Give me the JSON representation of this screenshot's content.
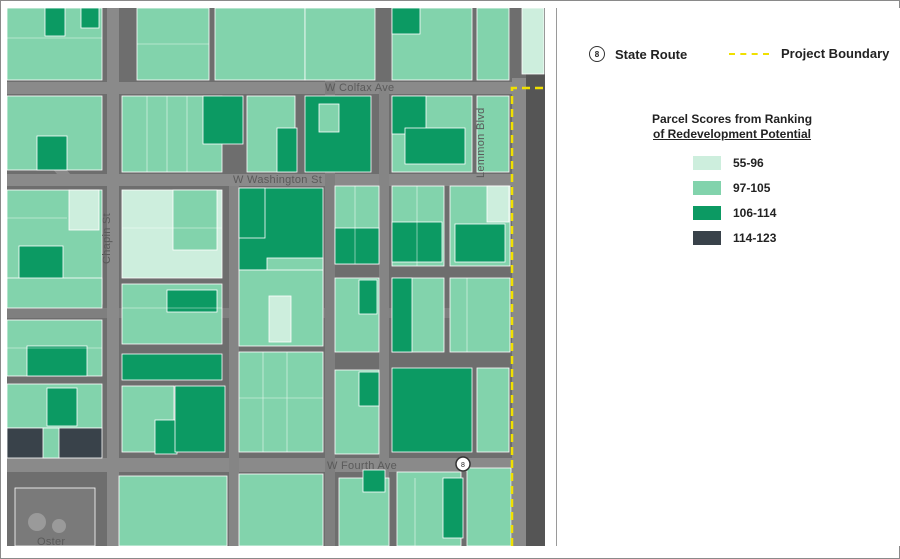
{
  "legend": {
    "state_route_label": "State Route",
    "state_route_icon": "state-route-shield-icon",
    "project_boundary_label": "Project Boundary",
    "title_line1": "Parcel Scores from Ranking",
    "title_line2": "of Redevelopment Potential",
    "classes": [
      {
        "label": "55-96",
        "color": "#cdeedd"
      },
      {
        "label": "97-105",
        "color": "#82d3ac"
      },
      {
        "label": "106-114",
        "color": "#0c9a63"
      },
      {
        "label": "114-123",
        "color": "#39424a"
      }
    ],
    "boundary_color": "#f0e000"
  },
  "map": {
    "streets": {
      "w_colfax": "W Colfax Ave",
      "w_washington": "W Washington St",
      "lemmon": "Lemmon Blvd",
      "chapin": "Chapin St",
      "w_fourth": "W Fourth Ave",
      "oster": "Oster"
    }
  }
}
